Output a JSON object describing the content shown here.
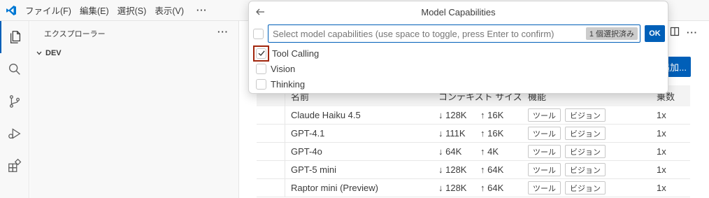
{
  "titlebar": {
    "menus": [
      "ファイル(F)",
      "編集(E)",
      "選択(S)",
      "表示(V)"
    ],
    "more": "···"
  },
  "activitybar": {
    "icons": [
      "files-icon",
      "search-icon",
      "source-control-icon",
      "run-debug-icon",
      "extensions-icon"
    ]
  },
  "sidebar": {
    "title": "エクスプローラー",
    "more": "···",
    "folder": "DEV"
  },
  "editor": {
    "add_button_label": "追加...",
    "table": {
      "headers": [
        "名前",
        "コンテキスト サイズ",
        "機能",
        "乗数"
      ],
      "rows": [
        {
          "name": "Claude Haiku 4.5",
          "input": "↓ 128K",
          "output": "↑ 16K",
          "caps": [
            "ツール",
            "ビジョン"
          ],
          "mult": "1x"
        },
        {
          "name": "GPT-4.1",
          "input": "↓ 111K",
          "output": "↑ 16K",
          "caps": [
            "ツール",
            "ビジョン"
          ],
          "mult": "1x"
        },
        {
          "name": "GPT-4o",
          "input": "↓ 64K",
          "output": "↑ 4K",
          "caps": [
            "ツール",
            "ビジョン"
          ],
          "mult": "1x"
        },
        {
          "name": "GPT-5 mini",
          "input": "↓ 128K",
          "output": "↑ 64K",
          "caps": [
            "ツール",
            "ビジョン"
          ],
          "mult": "1x"
        },
        {
          "name": "Raptor mini (Preview)",
          "input": "↓ 128K",
          "output": "↑ 64K",
          "caps": [
            "ツール",
            "ビジョン"
          ],
          "mult": "1x"
        }
      ]
    }
  },
  "quickpick": {
    "title": "Model Capabilities",
    "placeholder": "Select model capabilities (use space to toggle, press Enter to confirm)",
    "count_badge": "1 個選択済み",
    "ok_label": "OK",
    "items": [
      {
        "label": "Tool Calling",
        "checked": true
      },
      {
        "label": "Vision",
        "checked": false
      },
      {
        "label": "Thinking",
        "checked": false
      }
    ]
  },
  "colors": {
    "accent": "#005fb8",
    "focus_outline": "#a1260d"
  }
}
